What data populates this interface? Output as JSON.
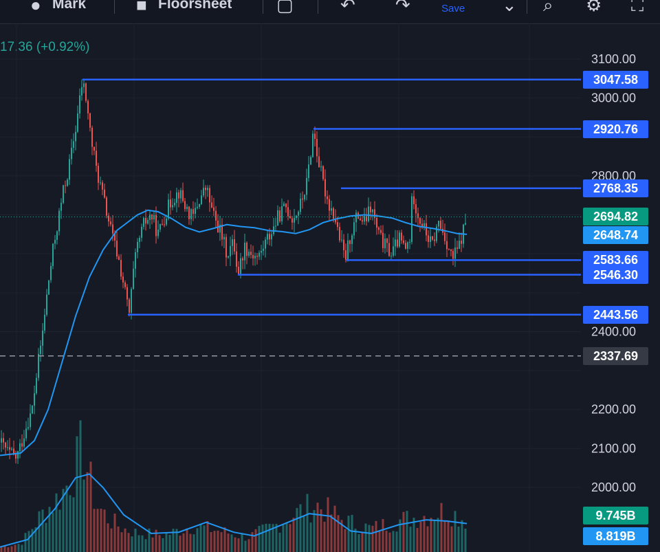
{
  "toolbar": {
    "mark_label": "Mark",
    "floorsheet_label": "Floorsheet",
    "save_label": "Save"
  },
  "header": {
    "price_change": "17.36 (+0.92%)"
  },
  "colors": {
    "background": "#161a25",
    "up": "#26a69a",
    "down": "#ef5350",
    "line": "#2962ff",
    "moving_average": "#2196f3",
    "text": "#d1d4dc",
    "current_price": "#089981",
    "muted_tag": "#363a45"
  },
  "chart_data": {
    "type": "candlestick",
    "y_axis": {
      "min": 1895,
      "max": 3170,
      "ticks": [
        "3100.00",
        "3000.00",
        "2800.00",
        "2400.00",
        "2200.00",
        "2100.00",
        "2000.00"
      ]
    },
    "horizontal_lines": [
      {
        "value": 3047.58,
        "label": "3047.58"
      },
      {
        "value": 2920.76,
        "label": "2920.76"
      },
      {
        "value": 2768.35,
        "label": "2768.35"
      },
      {
        "value": 2583.66,
        "label": "2583.66"
      },
      {
        "value": 2546.3,
        "label": "2546.30"
      },
      {
        "value": 2443.56,
        "label": "2443.56"
      }
    ],
    "price_tags": [
      {
        "label": "2694.82",
        "value": 2694.82,
        "kind": "last_price"
      },
      {
        "label": "2648.74",
        "value": 2648.74,
        "kind": "moving_average"
      },
      {
        "label": "2337.69",
        "value": 2337.69,
        "kind": "dashed_reference"
      }
    ],
    "volume_tags": [
      {
        "label": "9.745B",
        "kind": "volume"
      },
      {
        "label": "8.819B",
        "kind": "volume_average"
      }
    ],
    "price_path": [
      [
        0,
        2115
      ],
      [
        12,
        2090
      ],
      [
        24,
        2075
      ],
      [
        32,
        2120
      ],
      [
        40,
        2170
      ],
      [
        46,
        2190
      ],
      [
        54,
        2300
      ],
      [
        62,
        2400
      ],
      [
        70,
        2520
      ],
      [
        78,
        2620
      ],
      [
        86,
        2700
      ],
      [
        92,
        2760
      ],
      [
        100,
        2820
      ],
      [
        108,
        2900
      ],
      [
        114,
        2970
      ],
      [
        120,
        3045
      ],
      [
        126,
        2990
      ],
      [
        132,
        2900
      ],
      [
        140,
        2820
      ],
      [
        148,
        2760
      ],
      [
        156,
        2700
      ],
      [
        164,
        2640
      ],
      [
        172,
        2590
      ],
      [
        180,
        2520
      ],
      [
        188,
        2445
      ],
      [
        194,
        2550
      ],
      [
        200,
        2620
      ],
      [
        210,
        2680
      ],
      [
        220,
        2700
      ],
      [
        230,
        2650
      ],
      [
        240,
        2700
      ],
      [
        250,
        2740
      ],
      [
        260,
        2760
      ],
      [
        270,
        2720
      ],
      [
        280,
        2690
      ],
      [
        290,
        2740
      ],
      [
        300,
        2770
      ],
      [
        310,
        2700
      ],
      [
        320,
        2660
      ],
      [
        330,
        2600
      ],
      [
        340,
        2630
      ],
      [
        346,
        2550
      ],
      [
        356,
        2620
      ],
      [
        366,
        2600
      ],
      [
        376,
        2590
      ],
      [
        386,
        2630
      ],
      [
        396,
        2660
      ],
      [
        406,
        2700
      ],
      [
        416,
        2720
      ],
      [
        426,
        2690
      ],
      [
        436,
        2720
      ],
      [
        446,
        2780
      ],
      [
        456,
        2920
      ],
      [
        462,
        2850
      ],
      [
        470,
        2780
      ],
      [
        478,
        2730
      ],
      [
        486,
        2700
      ],
      [
        494,
        2640
      ],
      [
        502,
        2585
      ],
      [
        510,
        2650
      ],
      [
        520,
        2700
      ],
      [
        530,
        2680
      ],
      [
        540,
        2720
      ],
      [
        550,
        2650
      ],
      [
        560,
        2620
      ],
      [
        570,
        2600
      ],
      [
        580,
        2640
      ],
      [
        590,
        2610
      ],
      [
        596,
        2640
      ],
      [
        600,
        2760
      ],
      [
        608,
        2700
      ],
      [
        618,
        2660
      ],
      [
        628,
        2620
      ],
      [
        638,
        2680
      ],
      [
        648,
        2640
      ],
      [
        658,
        2585
      ],
      [
        668,
        2620
      ],
      [
        679,
        2695
      ]
    ],
    "ma_path": [
      [
        0,
        2082
      ],
      [
        30,
        2088
      ],
      [
        50,
        2120
      ],
      [
        70,
        2200
      ],
      [
        90,
        2320
      ],
      [
        110,
        2440
      ],
      [
        130,
        2540
      ],
      [
        150,
        2610
      ],
      [
        170,
        2660
      ],
      [
        185,
        2680
      ],
      [
        200,
        2700
      ],
      [
        215,
        2712
      ],
      [
        230,
        2708
      ],
      [
        250,
        2690
      ],
      [
        270,
        2668
      ],
      [
        290,
        2656
      ],
      [
        310,
        2665
      ],
      [
        330,
        2675
      ],
      [
        350,
        2670
      ],
      [
        370,
        2667
      ],
      [
        390,
        2660
      ],
      [
        410,
        2657
      ],
      [
        430,
        2652
      ],
      [
        450,
        2662
      ],
      [
        470,
        2680
      ],
      [
        490,
        2690
      ],
      [
        510,
        2697
      ],
      [
        530,
        2700
      ],
      [
        550,
        2697
      ],
      [
        570,
        2692
      ],
      [
        590,
        2680
      ],
      [
        610,
        2670
      ],
      [
        630,
        2665
      ],
      [
        650,
        2658
      ],
      [
        665,
        2652
      ],
      [
        679,
        2650
      ]
    ],
    "volume_path": [
      [
        0,
        0.05
      ],
      [
        30,
        0.08
      ],
      [
        60,
        0.35
      ],
      [
        90,
        0.55
      ],
      [
        110,
        0.8
      ],
      [
        120,
        1.0
      ],
      [
        130,
        0.7
      ],
      [
        140,
        0.45
      ],
      [
        160,
        0.3
      ],
      [
        180,
        0.22
      ],
      [
        200,
        0.18
      ],
      [
        240,
        0.16
      ],
      [
        280,
        0.25
      ],
      [
        320,
        0.2
      ],
      [
        360,
        0.14
      ],
      [
        400,
        0.25
      ],
      [
        440,
        0.4
      ],
      [
        460,
        0.45
      ],
      [
        500,
        0.3
      ],
      [
        540,
        0.22
      ],
      [
        580,
        0.3
      ],
      [
        620,
        0.35
      ],
      [
        650,
        0.4
      ],
      [
        679,
        0.3
      ]
    ],
    "volume_ma_path": [
      [
        0,
        0.04
      ],
      [
        40,
        0.1
      ],
      [
        80,
        0.35
      ],
      [
        110,
        0.6
      ],
      [
        130,
        0.63
      ],
      [
        150,
        0.52
      ],
      [
        180,
        0.3
      ],
      [
        220,
        0.15
      ],
      [
        260,
        0.16
      ],
      [
        300,
        0.24
      ],
      [
        340,
        0.16
      ],
      [
        370,
        0.13
      ],
      [
        410,
        0.22
      ],
      [
        450,
        0.31
      ],
      [
        480,
        0.29
      ],
      [
        510,
        0.17
      ],
      [
        540,
        0.15
      ],
      [
        580,
        0.22
      ],
      [
        620,
        0.26
      ],
      [
        650,
        0.25
      ],
      [
        679,
        0.23
      ]
    ]
  }
}
